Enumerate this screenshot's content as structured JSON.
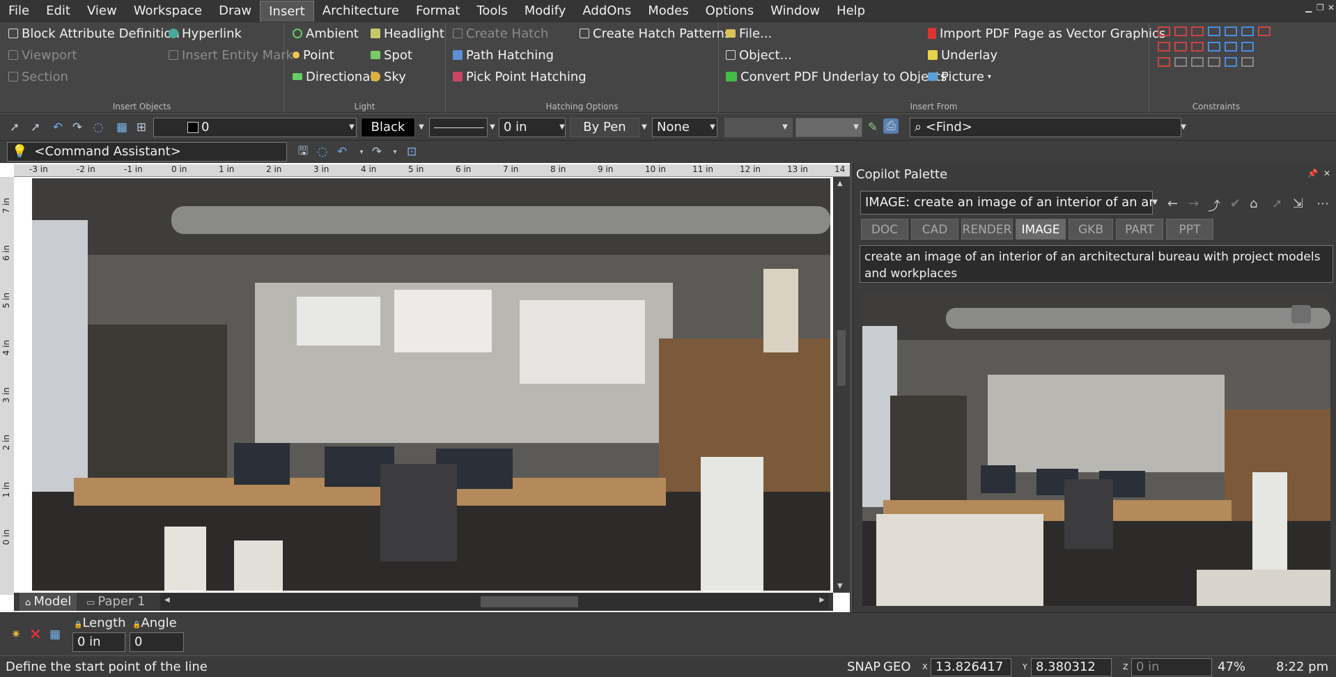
{
  "menu": [
    "File",
    "Edit",
    "View",
    "Workspace",
    "Draw",
    "Insert",
    "Architecture",
    "Format",
    "Tools",
    "Modify",
    "AddOns",
    "Modes",
    "Options",
    "Window",
    "Help"
  ],
  "menu_active": "Insert",
  "ribbon": {
    "insert_objects": {
      "label": "Insert Objects",
      "block_attr": "Block Attribute Definition",
      "hyperlink": "Hyperlink",
      "viewport": "Viewport",
      "insert_entity_mark": "Insert Entity Mark",
      "section": "Section"
    },
    "light": {
      "label": "Light",
      "ambient": "Ambient",
      "headlight": "Headlight",
      "point": "Point",
      "spot": "Spot",
      "directional": "Directional",
      "sky": "Sky"
    },
    "hatching": {
      "label": "Hatching Options",
      "create_hatch": "Create Hatch",
      "create_hatch_patterns": "Create Hatch Patterns",
      "path_hatching": "Path Hatching",
      "pick_point_hatching": "Pick Point Hatching"
    },
    "insert_from": {
      "label": "Insert From",
      "file": "File...",
      "object": "Object...",
      "convert_pdf": "Convert PDF Underlay to Objects",
      "import_pdf": "Import PDF Page as Vector Graphics",
      "underlay": "Underlay",
      "picture": "Picture"
    },
    "constraints": {
      "label": "Constraints"
    }
  },
  "toolbar": {
    "layer": "0",
    "color": "Black",
    "lineweight": "0 in",
    "linestyle_mode": "By Pen",
    "fill": "None",
    "find_placeholder": "<Find>",
    "command_assistant": "<Command Assistant>"
  },
  "ruler": {
    "top": [
      "-3 in",
      "-2 in",
      "-1 in",
      "0 in",
      "1 in",
      "2 in",
      "3 in",
      "4 in",
      "5 in",
      "6 in",
      "7 in",
      "8 in",
      "9 in",
      "10 in",
      "11 in",
      "12 in",
      "13 in",
      "14"
    ],
    "left": [
      "7 in",
      "6 in",
      "5 in",
      "4 in",
      "3 in",
      "2 in",
      "1 in",
      "0 in"
    ]
  },
  "layout_tabs": {
    "model": "Model",
    "paper": "Paper 1"
  },
  "palette": {
    "title": "Copilot Palette",
    "query": "IMAGE: create an image of an interior of an archi",
    "tabs": [
      "DOC",
      "CAD",
      "RENDER",
      "IMAGE",
      "GKB",
      "PART",
      "PPT"
    ],
    "active_tab": "IMAGE",
    "prompt": "create an image of an interior of an architectural bureau with project models and workplaces"
  },
  "cmd": {
    "length_label": "Length",
    "angle_label": "Angle",
    "length_value": "0 in",
    "angle_value": "0"
  },
  "status": {
    "message": "Define the start point of the line",
    "snap": "SNAP",
    "geo": "GEO",
    "x_label": "X",
    "y_label": "Y",
    "z_label": "Z",
    "x": "13.826417 in",
    "y": "8.380312 in",
    "z": "0 in",
    "zoom": "47%",
    "time": "8:22 pm"
  }
}
